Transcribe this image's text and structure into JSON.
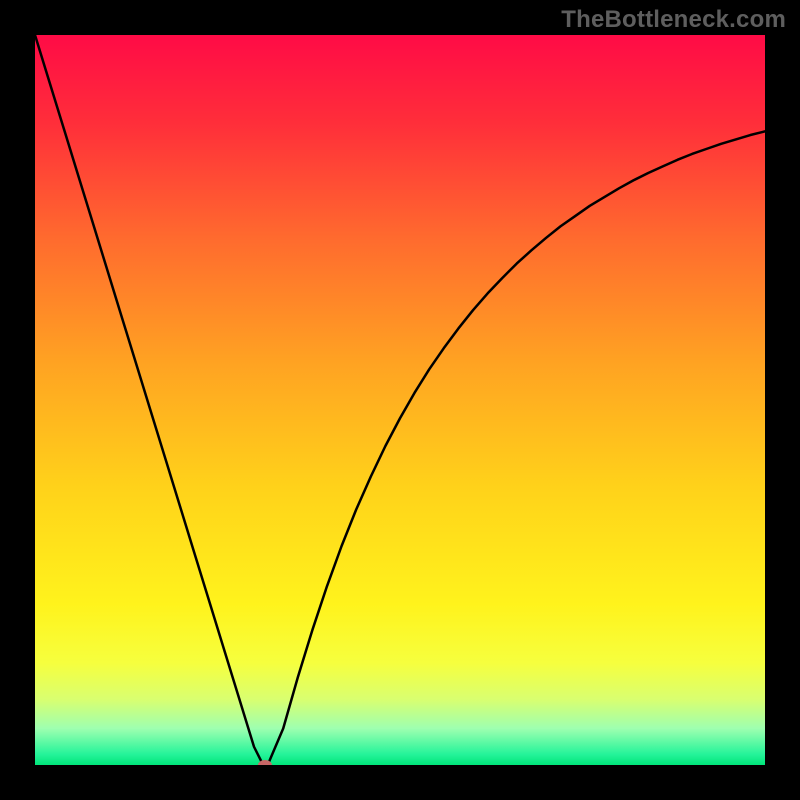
{
  "watermark": "TheBottleneck.com",
  "chart_data": {
    "type": "line",
    "title": "",
    "xlabel": "",
    "ylabel": "",
    "xlim": [
      0,
      100
    ],
    "ylim": [
      0,
      100
    ],
    "grid": false,
    "legend": false,
    "annotations": [],
    "background": {
      "type": "vertical-gradient",
      "stops": [
        {
          "offset": 0.0,
          "color": "#ff0b46"
        },
        {
          "offset": 0.12,
          "color": "#ff2e3a"
        },
        {
          "offset": 0.28,
          "color": "#ff6b2e"
        },
        {
          "offset": 0.45,
          "color": "#ffa322"
        },
        {
          "offset": 0.62,
          "color": "#ffd21a"
        },
        {
          "offset": 0.78,
          "color": "#fff31c"
        },
        {
          "offset": 0.86,
          "color": "#f6ff3e"
        },
        {
          "offset": 0.91,
          "color": "#d9ff70"
        },
        {
          "offset": 0.95,
          "color": "#9effb0"
        },
        {
          "offset": 0.985,
          "color": "#26f49a"
        },
        {
          "offset": 1.0,
          "color": "#00e57a"
        }
      ]
    },
    "series": [
      {
        "name": "bottleneck-curve",
        "color": "#000000",
        "stroke_width": 2.5,
        "x": [
          0.0,
          2.0,
          4.0,
          6.0,
          8.0,
          10.0,
          12.0,
          14.0,
          16.0,
          18.0,
          20.0,
          22.0,
          24.0,
          26.0,
          28.0,
          30.0,
          31.0,
          31.5,
          32.0,
          34.0,
          36.0,
          38.0,
          40.0,
          42.0,
          44.0,
          46.0,
          48.0,
          50.0,
          52.0,
          54.0,
          56.0,
          58.0,
          60.0,
          62.0,
          64.0,
          66.0,
          68.0,
          70.0,
          72.0,
          74.0,
          76.0,
          78.0,
          80.0,
          82.0,
          84.0,
          86.0,
          88.0,
          90.0,
          92.0,
          94.0,
          96.0,
          98.0,
          100.0
        ],
        "y": [
          100.0,
          93.5,
          87.0,
          80.5,
          74.0,
          67.5,
          61.0,
          54.5,
          48.0,
          41.5,
          35.0,
          28.5,
          22.0,
          15.5,
          9.0,
          2.5,
          0.5,
          0.0,
          0.3,
          5.0,
          12.0,
          18.5,
          24.5,
          30.0,
          35.0,
          39.5,
          43.7,
          47.5,
          51.0,
          54.2,
          57.1,
          59.8,
          62.3,
          64.6,
          66.7,
          68.7,
          70.5,
          72.2,
          73.8,
          75.2,
          76.6,
          77.8,
          79.0,
          80.1,
          81.1,
          82.0,
          82.9,
          83.7,
          84.4,
          85.1,
          85.7,
          86.3,
          86.8
        ]
      }
    ],
    "marker": {
      "name": "optimal-point",
      "x": 31.5,
      "y": 0.0,
      "color": "#c86666",
      "rx": 7,
      "ry": 5
    }
  }
}
